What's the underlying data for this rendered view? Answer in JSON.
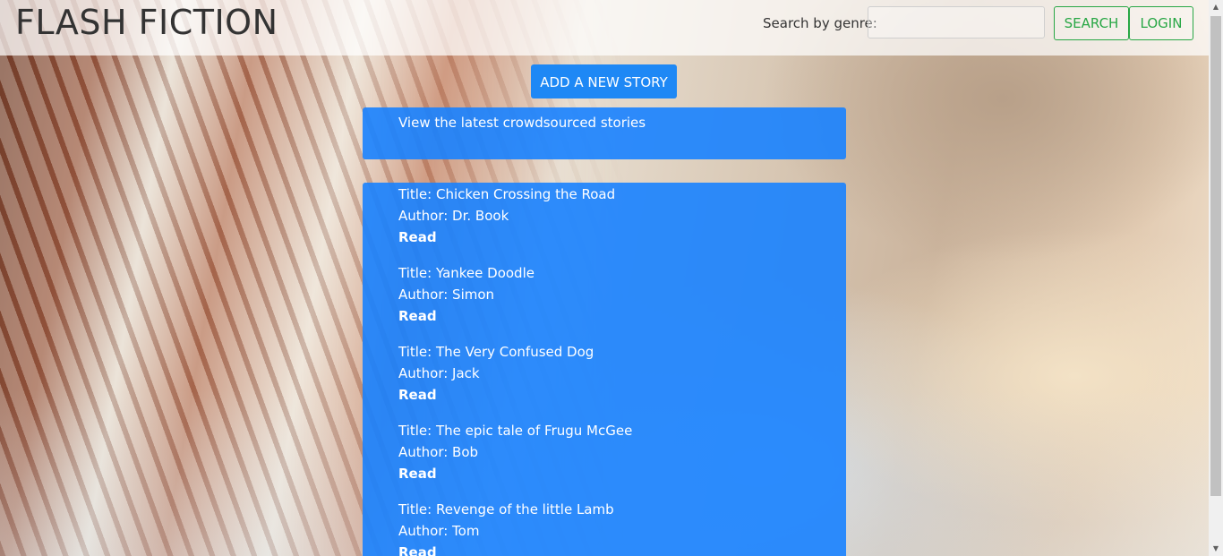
{
  "header": {
    "brand": "FLASH FICTION",
    "search_label": "Search by genre:",
    "search_placeholder": "",
    "search_value": "",
    "search_button": "SEARCH",
    "login_button": "LOGIN"
  },
  "main": {
    "add_button": "ADD A NEW STORY",
    "intro_text": "View the latest crowdsourced stories",
    "stories": [
      {
        "title": "Title: Chicken Crossing the Road",
        "author": "Author: Dr. Book",
        "read": "Read"
      },
      {
        "title": "Title: Yankee Doodle",
        "author": "Author: Simon",
        "read": "Read"
      },
      {
        "title": "Title: The Very Confused Dog",
        "author": "Author: Jack",
        "read": "Read"
      },
      {
        "title": "Title: The epic tale of Frugu McGee",
        "author": "Author: Bob",
        "read": "Read"
      },
      {
        "title": "Title: Revenge of the little Lamb",
        "author": "Author: Tom",
        "read": "Read"
      }
    ]
  },
  "colors": {
    "accent": "#1e88f5",
    "outline_green": "#28a745",
    "panel_blue": "#1882ff"
  },
  "scrollbar": {
    "up_icon": "triangle-up",
    "down_icon": "triangle-down"
  }
}
